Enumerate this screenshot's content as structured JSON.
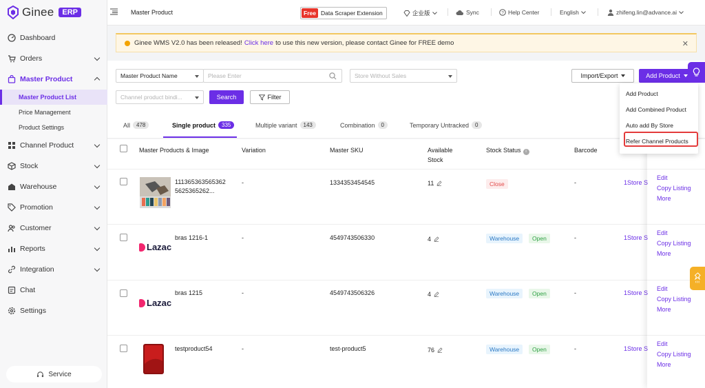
{
  "brand": {
    "name": "Ginee",
    "badge": "ERP",
    "color": "#6b2ee6"
  },
  "sidebar": {
    "items": [
      {
        "label": "Dashboard",
        "icon": "dashboard-icon"
      },
      {
        "label": "Orders",
        "icon": "cart-icon"
      },
      {
        "label": "Master Product",
        "icon": "bag-icon"
      },
      {
        "label": "Channel Product",
        "icon": "grid-icon"
      },
      {
        "label": "Stock",
        "icon": "box-icon"
      },
      {
        "label": "Warehouse",
        "icon": "warehouse-icon"
      },
      {
        "label": "Promotion",
        "icon": "tag-icon"
      },
      {
        "label": "Customer",
        "icon": "users-icon"
      },
      {
        "label": "Reports",
        "icon": "chart-icon"
      },
      {
        "label": "Integration",
        "icon": "link-icon"
      },
      {
        "label": "Chat",
        "icon": "chat-icon"
      },
      {
        "label": "Settings",
        "icon": "gear-icon"
      }
    ],
    "sub_items": [
      "Master Product List",
      "Price Management",
      "Product Settings"
    ],
    "service": "Service"
  },
  "topbar": {
    "page_title": "Master Product",
    "free_tag": "Free",
    "scraper": "Data Scraper Extension",
    "enterprise": "企业版",
    "sync": "Sync",
    "help": "Help Center",
    "language": "English",
    "user": "zhifeng.lin@advance.ai"
  },
  "banner": {
    "prefix": "Ginee WMS V2.0 has been released!",
    "link": "Click here",
    "suffix": "to use this new version, please contact Ginee for FREE demo"
  },
  "filters": {
    "search_type": "Master Product Name",
    "search_placeholder": "Please Enter",
    "store_placeholder": "Store Without Sales",
    "channel_placeholder": "Channel product bindi...",
    "search_btn": "Search",
    "filter_btn": "Filter",
    "import_export": "Import/Export",
    "add_product": "Add Product"
  },
  "tabs": [
    {
      "label": "All",
      "count": "478"
    },
    {
      "label": "Single product",
      "count": "335"
    },
    {
      "label": "Multiple variant",
      "count": "143"
    },
    {
      "label": "Combination",
      "count": "0"
    },
    {
      "label": "Temporary Untracked",
      "count": "0"
    }
  ],
  "table": {
    "headers": {
      "product": "Master Products & Image",
      "variation": "Variation",
      "sku": "Master SKU",
      "stock": "Available Stock",
      "status": "Stock Status",
      "barcode": "Barcode"
    },
    "rows": [
      {
        "name": "1113653635653625625365262...",
        "variation": "-",
        "sku": "1334353454545",
        "stock": "11",
        "status": [
          "Close"
        ],
        "barcode": "-",
        "store": "1Store S",
        "thumb": "shoes"
      },
      {
        "name": "bras 1216-1",
        "variation": "-",
        "sku": "4549743506330",
        "stock": "4",
        "status": [
          "Warehouse",
          "Open"
        ],
        "barcode": "-",
        "store": "1Store S",
        "thumb": "lazada",
        "logo_text": "Lazac"
      },
      {
        "name": "bras 1215",
        "variation": "-",
        "sku": "4549743506326",
        "stock": "4",
        "status": [
          "Warehouse",
          "Open"
        ],
        "barcode": "-",
        "store": "1Store S",
        "thumb": "lazada",
        "logo_text": "Lazac"
      },
      {
        "name": "testproduct54",
        "variation": "-",
        "sku": "test-product5",
        "stock": "76",
        "status": [
          "Warehouse",
          "Open"
        ],
        "barcode": "-",
        "store": "1Store S",
        "thumb": "phone"
      }
    ],
    "actions": [
      "Edit",
      "Copy Listing",
      "More"
    ]
  },
  "dropdown": {
    "items": [
      "Add Product",
      "Add Combined Product",
      "Auto add By Store",
      "Refer Channel Products"
    ]
  }
}
